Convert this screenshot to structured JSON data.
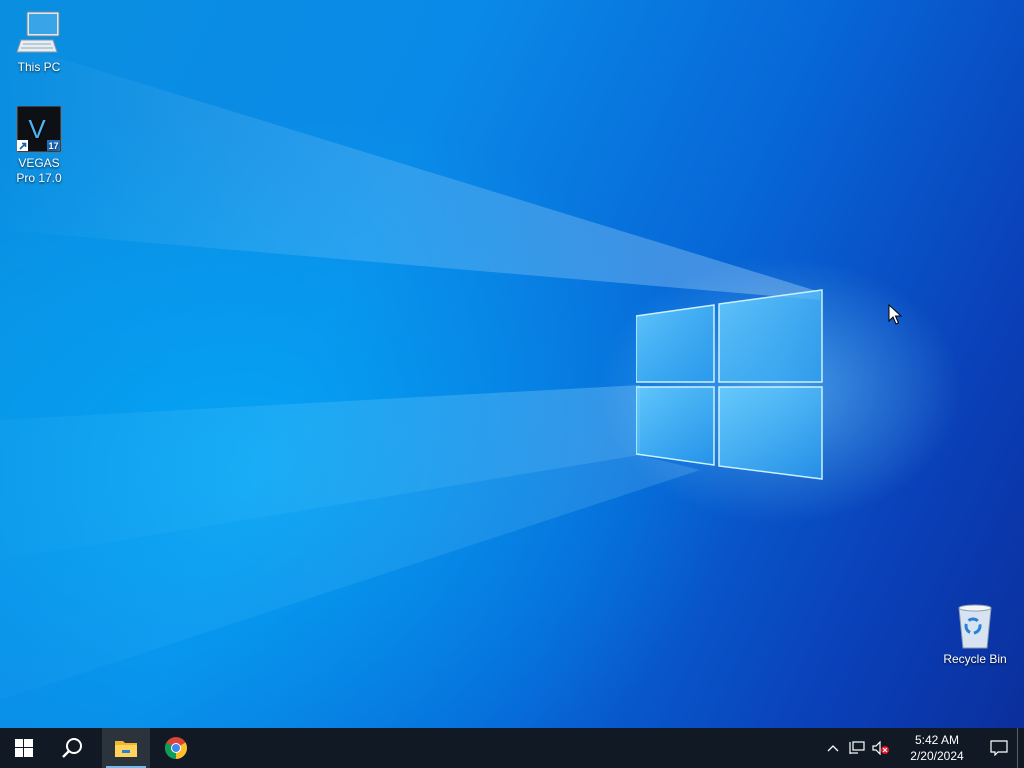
{
  "desktop": {
    "icons": [
      {
        "label": "This PC",
        "icon": "this-pc-icon"
      },
      {
        "label": "VEGAS Pro 17.0",
        "icon": "vegas-pro-icon",
        "badge_letter": "V",
        "badge_number": "17"
      },
      {
        "label": "Recycle Bin",
        "icon": "recycle-bin-icon"
      }
    ],
    "wallpaper": "windows-10-hero",
    "colors": {
      "accent": "#0a78d7",
      "taskbar": "#111a24"
    }
  },
  "taskbar": {
    "items": [
      {
        "name": "Start",
        "icon": "windows-start-icon"
      },
      {
        "name": "Search",
        "icon": "search-icon"
      },
      {
        "name": "File Explorer",
        "icon": "file-explorer-icon",
        "active": true
      },
      {
        "name": "Google Chrome",
        "icon": "chrome-icon"
      }
    ],
    "tray": {
      "icons": [
        "chevron-up-icon",
        "network-icon",
        "speaker-muted-icon"
      ],
      "time": "5:42 AM",
      "date": "2/20/2024",
      "notification_icon": "action-center-icon"
    }
  }
}
